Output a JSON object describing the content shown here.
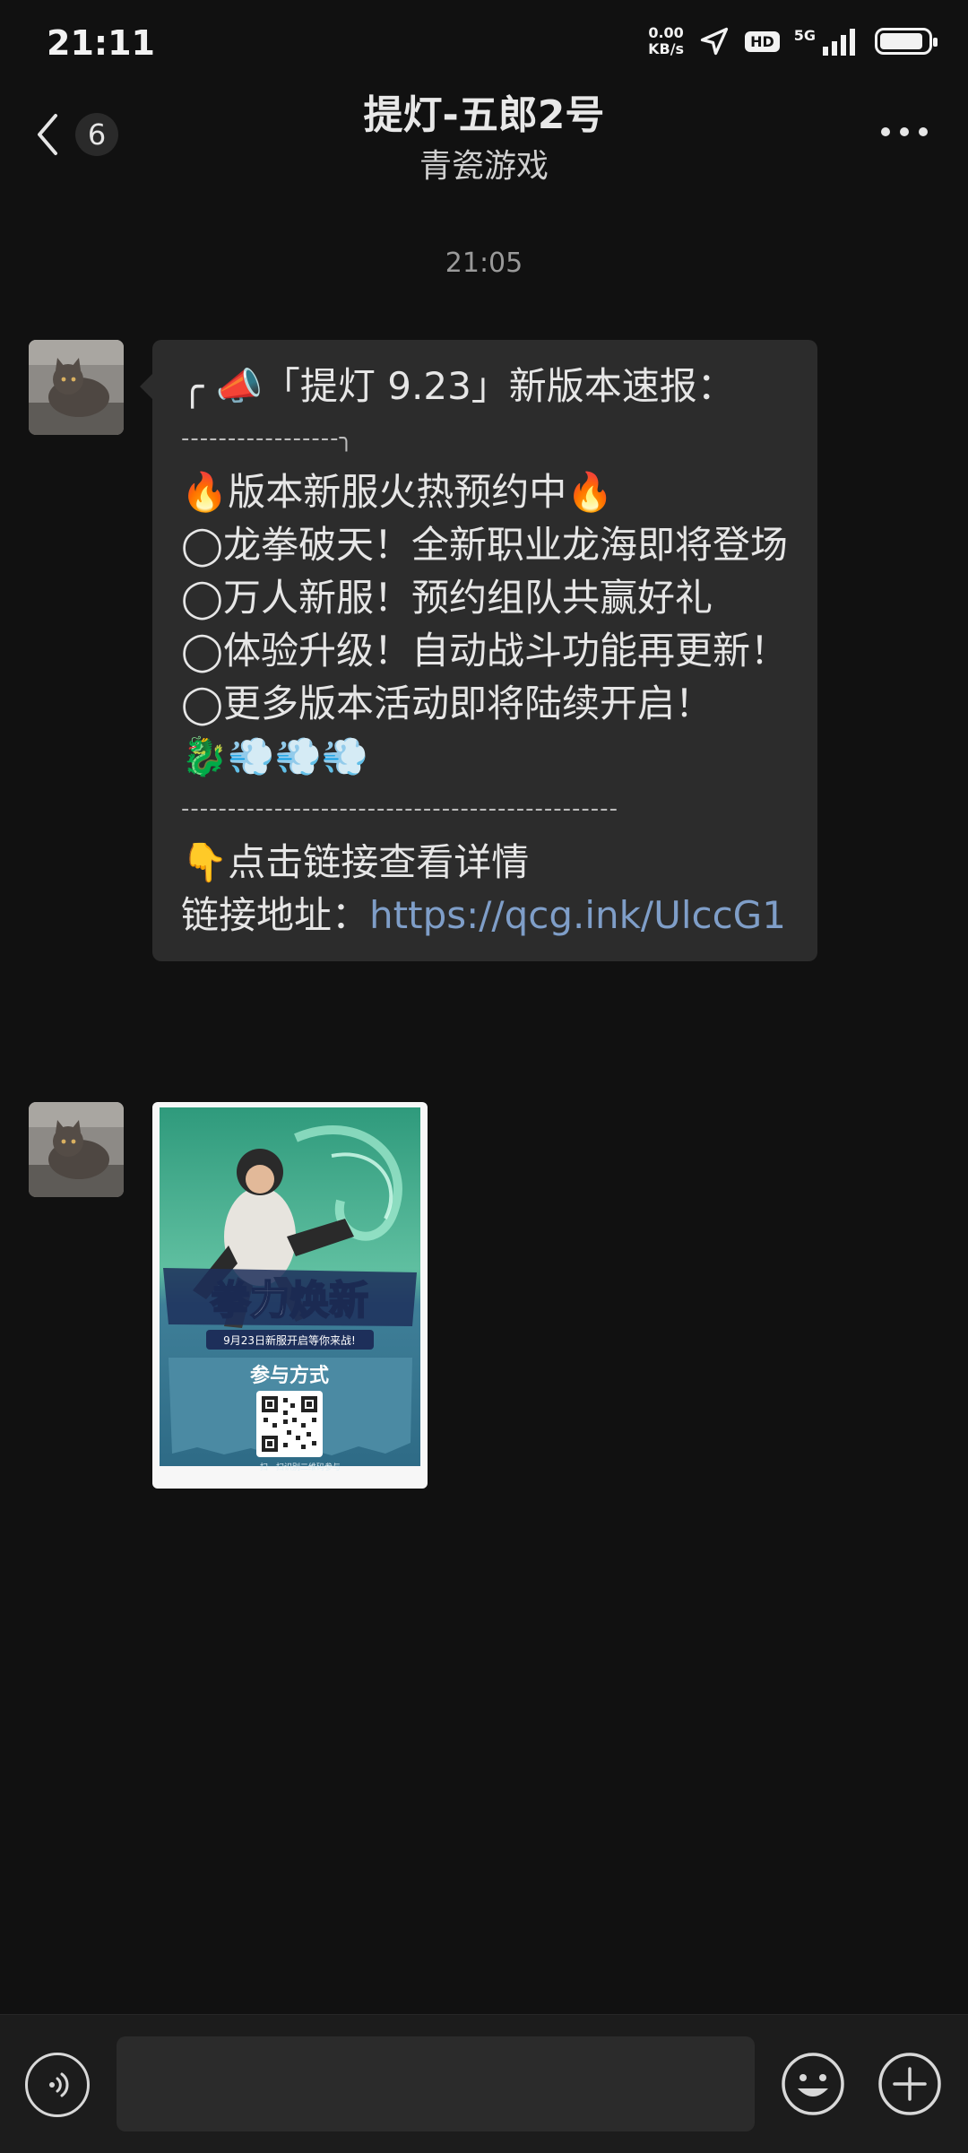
{
  "status_bar": {
    "time": "21:11",
    "net_speed_value": "0.00",
    "net_speed_unit": "KB/s",
    "hd": "HD",
    "net_type": "5G",
    "battery_level": 0.9
  },
  "header": {
    "unread_count": "6",
    "title": "提灯-五郎2号",
    "subtitle": "青瓷游戏"
  },
  "timestamp": "21:05",
  "message": {
    "line1": "╭ 📣「提灯 9.23」新版本速报：",
    "line2": "-----------------╮",
    "line3": "🔥版本新服火热预约中🔥",
    "line4": "◯龙拳破天！全新职业龙海即将登场",
    "line5": "◯万人新服！预约组队共赢好礼",
    "line6": "◯体验升级！自动战斗功能再更新！",
    "line7": "◯更多版本活动即将陆续开启！",
    "line8": "🐉💨💨💨",
    "line9": "-----------------------------------------------",
    "line10": "👇点击链接查看详情",
    "link_label": "链接地址：",
    "link_url": "https://qcg.ink/UlccG1"
  },
  "poster": {
    "title": "拳力焕新",
    "tagline": "9月23日新服开启等你来战!",
    "section": "参与方式",
    "scan_hint": "扫一扫识别二维码参与"
  },
  "input": {
    "placeholder": ""
  },
  "colors": {
    "background": "#111111",
    "bubble": "#2c2c2c",
    "link": "#7f9ec8",
    "bottom_bar": "#1c1c1c"
  }
}
